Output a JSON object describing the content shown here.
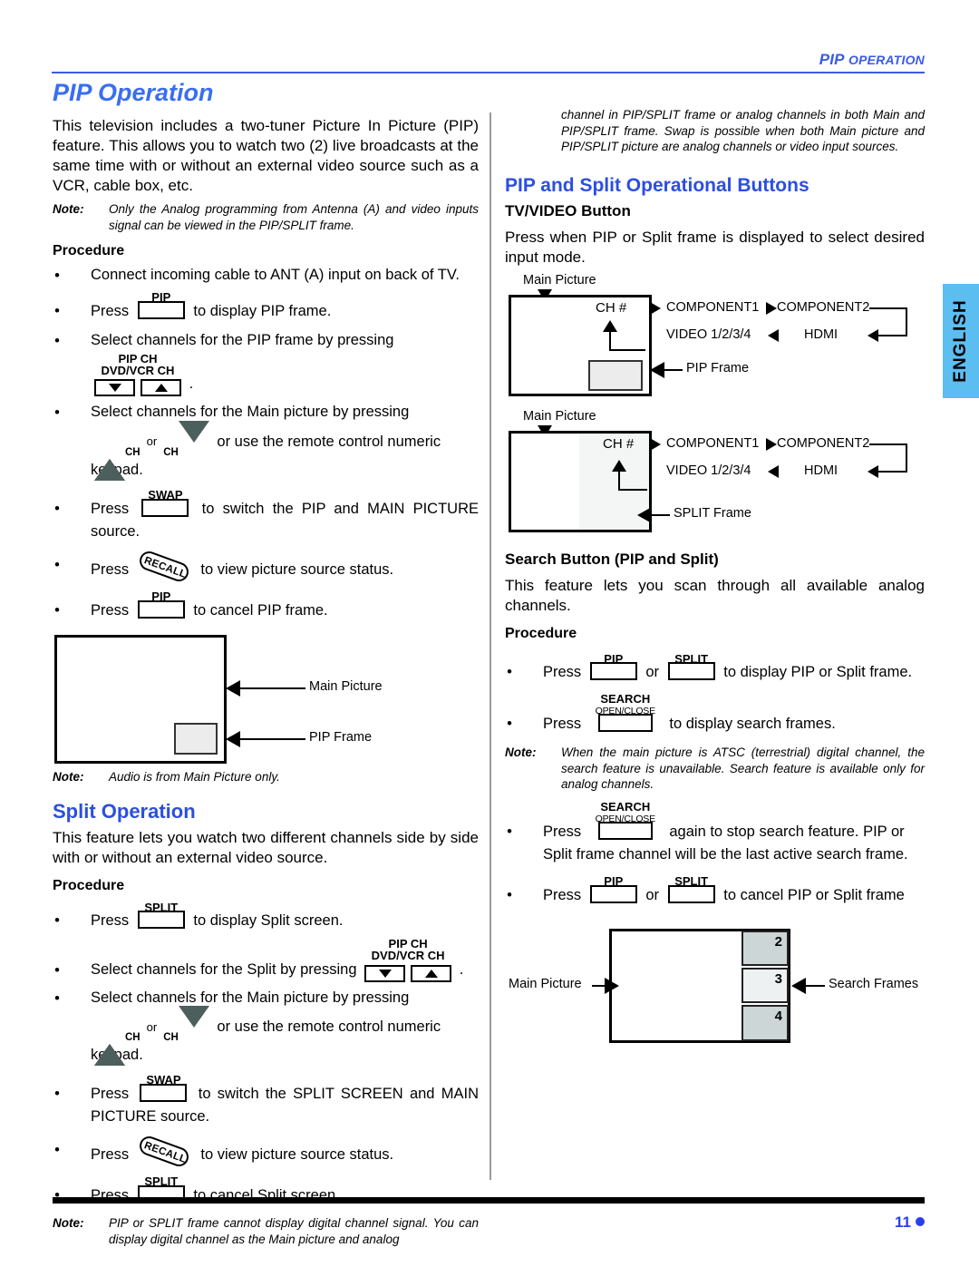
{
  "header": {
    "title_main": "PIP ",
    "title_rest": "OPERATION"
  },
  "lang_tab": {
    "label": "ENGLISH"
  },
  "footer": {
    "page_number": "11"
  },
  "left": {
    "h1": "PIP Operation",
    "intro": "This television includes a two-tuner Picture In Picture (PIP) feature. This allows you to watch two (2) live broadcasts at the same time with or without an external video source such as a VCR, cable box, etc.",
    "note1_label": "Note:",
    "note1_text": "Only the Analog programming from Antenna (A) and video inputs signal can be viewed in the PIP/SPLIT frame.",
    "procedure_heading": "Procedure",
    "bullets": [
      {
        "text": "Connect incoming cable to ANT (A) input on back of TV."
      },
      {
        "pre": "Press",
        "key": "PIP",
        "post": "to display PIP frame."
      },
      {
        "text": "Select channels for the PIP frame by pressing"
      },
      {
        "key_top": "PIP CH",
        "key_bottom": "DVD/VCR CH",
        "trailing": "."
      },
      {
        "text": "Select channels for the Main picture by pressing"
      },
      {
        "ch_up": "CH",
        "ch_or": "or",
        "ch_down": "CH",
        "post": "or use the remote control numeric keypad."
      },
      {
        "pre": "Press",
        "key": "SWAP",
        "post": "to switch the PIP and MAIN PICTURE source."
      },
      {
        "pre": "Press",
        "key": "RECALL",
        "post": "to view picture source status."
      },
      {
        "pre": "Press",
        "key": "PIP",
        "post": "to cancel PIP frame."
      }
    ],
    "diagram1": {
      "main_label": "Main Picture",
      "pip_label": "PIP Frame"
    },
    "note2_label": "Note:",
    "note2_text": "Audio is from Main Picture only.",
    "h2_split": "Split Operation",
    "split_intro": "This feature lets you watch two different channels side by side with or without an external video source.",
    "split_procedure_heading": "Procedure",
    "split_bullets": [
      {
        "pre": "Press",
        "key": "SPLIT",
        "post": "to display Split screen."
      },
      {
        "text": "Select channels for the Split by pressing",
        "key_top": "PIP CH",
        "key_bottom": "DVD/VCR CH",
        "trailing": "."
      },
      {
        "text": "Select channels for the Main picture by pressing"
      },
      {
        "ch_up": "CH",
        "ch_or": "or",
        "ch_down": "CH",
        "post": "or use the remote control numeric keypad."
      },
      {
        "pre": "Press",
        "key": "SWAP",
        "post": "to switch the SPLIT SCREEN and MAIN PICTURE source."
      },
      {
        "pre": "Press",
        "key": "RECALL",
        "post": "to view picture source status."
      },
      {
        "pre": "Press",
        "key": "SPLIT",
        "post": "to cancel Split screen."
      }
    ],
    "note3_label": "Note:",
    "note3_text": "PIP or SPLIT frame cannot display digital channel signal. You can display digital channel as the Main picture and analog"
  },
  "right": {
    "note_cont": "channel in PIP/SPLIT frame or analog channels in both Main and PIP/SPLIT frame. Swap is possible when both Main picture and PIP/SPLIT picture are analog channels or video input sources.",
    "h2_buttons": "PIP and Split Operational Buttons",
    "h3_tvvideo": "TV/VIDEO Button",
    "tvvideo_text": "Press when PIP or Split frame is displayed to select desired input mode.",
    "diagram_pip": {
      "main_label": "Main Picture",
      "ch_label": "CH #",
      "comp1": "COMPONENT1",
      "comp2": "COMPONENT2",
      "video": "VIDEO 1/2/3/4",
      "hdmi": "HDMI",
      "frame_label": "PIP Frame"
    },
    "diagram_split": {
      "main_label": "Main Picture",
      "ch_label": "CH #",
      "comp1": "COMPONENT1",
      "comp2": "COMPONENT2",
      "video": "VIDEO 1/2/3/4",
      "hdmi": "HDMI",
      "frame_label": "SPLIT Frame"
    },
    "h3_search": "Search Button (PIP and Split)",
    "search_intro": "This feature lets you scan through all available analog channels.",
    "search_procedure_heading": "Procedure",
    "search_bullets": [
      {
        "pre": "Press",
        "key1": "PIP",
        "mid": "or",
        "key2": "SPLIT",
        "post": "to display PIP or Split frame."
      },
      {
        "pre": "Press",
        "key_top": "SEARCH",
        "key_sub": "OPEN/CLOSE",
        "post": "to display search frames."
      }
    ],
    "note_label": "Note:",
    "note_text": "When the main picture is ATSC (terrestrial) digital channel, the search feature is unavailable. Search feature is available only for analog channels.",
    "search_bullets2": [
      {
        "pre": "Press",
        "key_top": "SEARCH",
        "key_sub": "OPEN/CLOSE",
        "post": "again to stop search feature. PIP or Split frame channel will be the last active search frame."
      },
      {
        "pre": "Press",
        "key1": "PIP",
        "mid": "or",
        "key2": "SPLIT",
        "post": "to cancel PIP or Split frame"
      }
    ],
    "diagram_search": {
      "main_label": "Main Picture",
      "frames_label": "Search Frames",
      "frame_numbers": [
        "2",
        "3",
        "4"
      ]
    }
  }
}
